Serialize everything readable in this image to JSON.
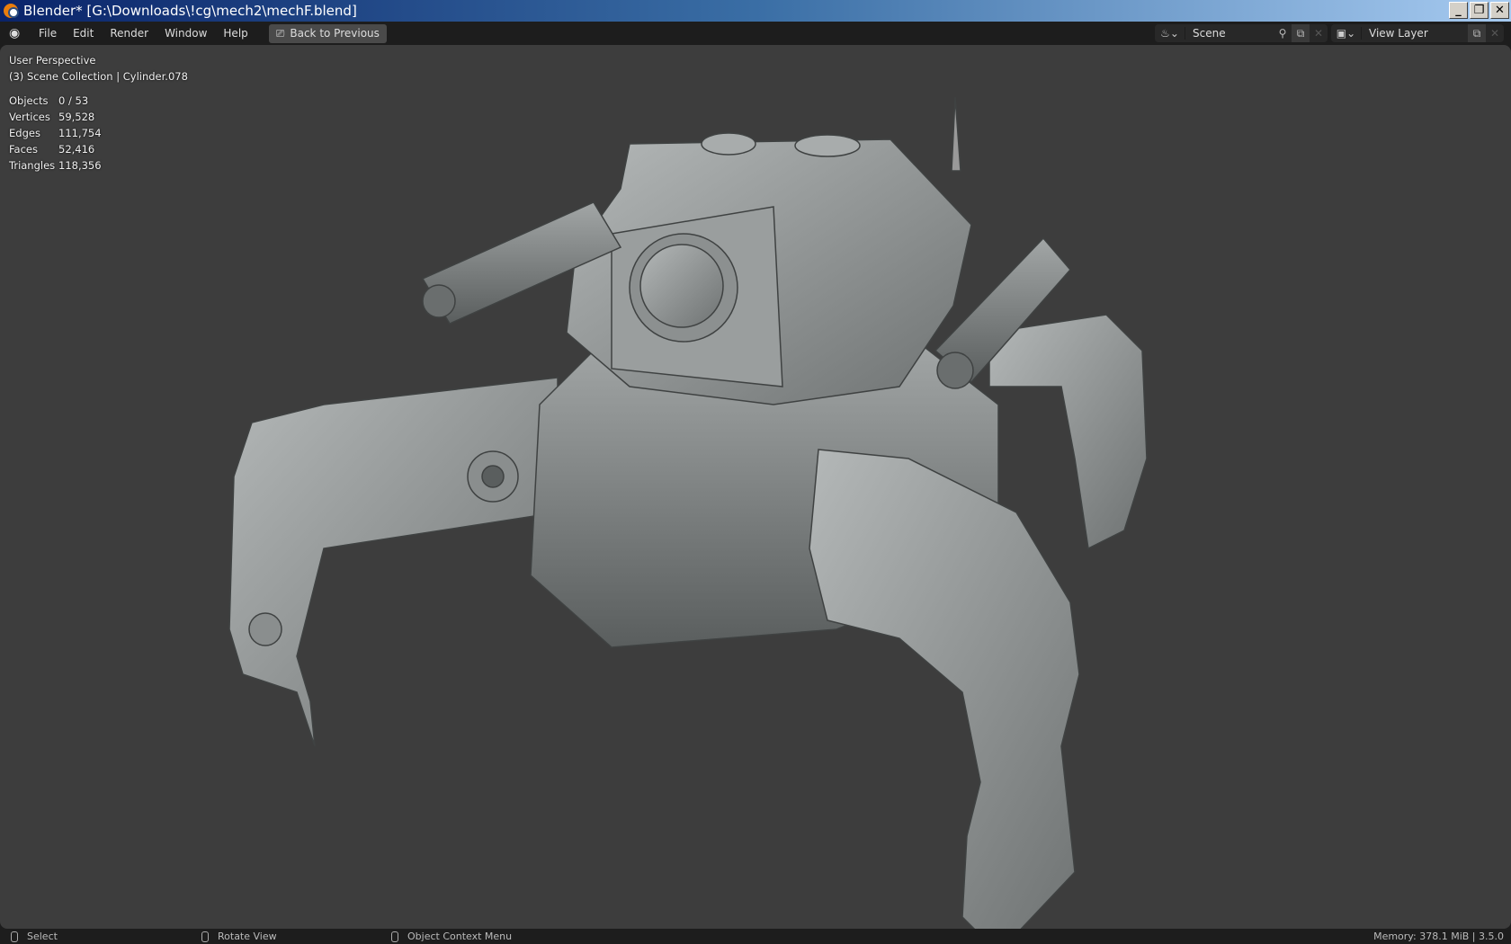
{
  "window": {
    "title": "Blender* [G:\\Downloads\\!cg\\mech2\\mechF.blend]",
    "controls": [
      "_",
      "❐",
      "✕"
    ]
  },
  "menu": {
    "items": [
      "File",
      "Edit",
      "Render",
      "Window",
      "Help"
    ],
    "back_button": "Back to Previous"
  },
  "scene": {
    "label": "Scene"
  },
  "view_layer": {
    "label": "View Layer"
  },
  "viewport": {
    "perspective": "User Perspective",
    "collection": "(3) Scene Collection | Cylinder.078",
    "stats": [
      {
        "label": "Objects",
        "value": "0 / 53"
      },
      {
        "label": "Vertices",
        "value": "59,528"
      },
      {
        "label": "Edges",
        "value": "111,754"
      },
      {
        "label": "Faces",
        "value": "52,416"
      },
      {
        "label": "Triangles",
        "value": "118,356"
      }
    ]
  },
  "status": {
    "select": "Select",
    "rotate": "Rotate View",
    "context": "Object Context Menu",
    "memory": "Memory: 378.1 MiB | 3.5.0"
  }
}
